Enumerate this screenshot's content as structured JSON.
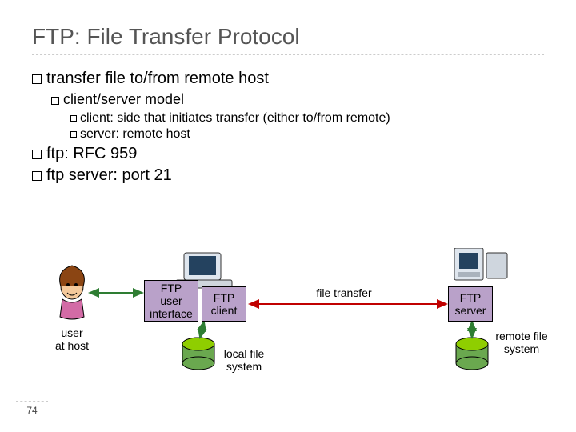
{
  "title": "FTP: File Transfer Protocol",
  "bullets": {
    "l1a": "transfer file to/from remote host",
    "l2a": "client/server model",
    "l3a": "client: side that initiates transfer (either to/from remote)",
    "l3b": "server: remote host",
    "l1b": "ftp: RFC 959",
    "l1c": "ftp server: port 21"
  },
  "diagram": {
    "ui_box": "FTP\nuser\ninterface",
    "client_box": "FTP\nclient",
    "server_box": "FTP\nserver",
    "user_label": "user\nat host",
    "local_fs": "local file\nsystem",
    "remote_fs": "remote file\nsystem",
    "transfer_label": "file transfer"
  },
  "page_number": "74"
}
